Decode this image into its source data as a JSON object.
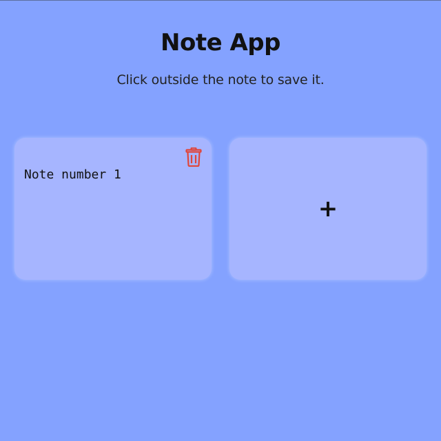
{
  "header": {
    "title": "Note App",
    "subtitle": "Click outside the note to save it."
  },
  "notes": [
    {
      "text": "Note number 1",
      "delete_icon": "trash-icon"
    }
  ],
  "add_button": {
    "symbol": "+",
    "icon": "plus-icon"
  },
  "colors": {
    "background": "#84a2ff",
    "card": "#a6b5ff",
    "delete_icon": "#e0453a",
    "text": "#111111"
  }
}
